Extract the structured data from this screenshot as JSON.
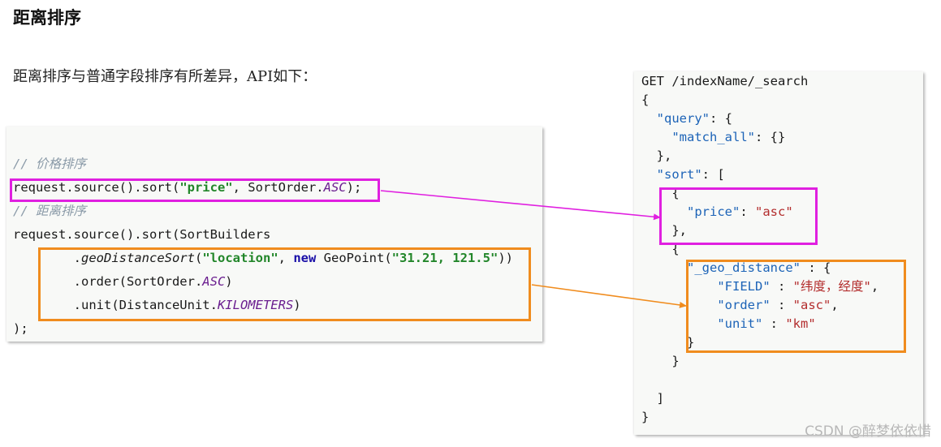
{
  "title": "距离排序",
  "description": "距离排序与普通字段排序有所差异，API如下：",
  "java": {
    "comment_price": "// 价格排序",
    "price_sort": {
      "prefix": "request.source().sort(",
      "field": "\"price\"",
      "mid": ", SortOrder.",
      "order": "ASC",
      "suffix": ");"
    },
    "comment_distance": "// 距离排序",
    "distance_line": "request.source().sort(SortBuilders",
    "geo_line": {
      "dot": ".",
      "method": "geoDistanceSort",
      "open": "(",
      "field": "\"location\"",
      "sep": ", ",
      "new_kw": "new",
      "geopoint": " GeoPoint(",
      "coords": "\"31.21, 121.5\"",
      "close": "))"
    },
    "order_line": {
      "prefix": ".order(SortOrder.",
      "value": "ASC",
      "suffix": ")"
    },
    "unit_line": {
      "prefix": ".unit(DistanceUnit.",
      "value": "KILOMETERS",
      "suffix": ")"
    },
    "end": ");"
  },
  "json": {
    "request": "GET /indexName/_search",
    "open": "{",
    "query_key": "\"query\"",
    "query_open": ": {",
    "match_all_key": "\"match_all\"",
    "match_all_val": ": {}",
    "query_close": "},",
    "sort_key": "\"sort\"",
    "sort_open": ": [",
    "obj_open": "{",
    "price_key": "\"price\"",
    "colon": ": ",
    "price_val": "\"asc\"",
    "obj_close_comma": "},",
    "obj2_open": "{",
    "geo_key": "\"_geo_distance\"",
    "geo_open": " : {",
    "field_key": "\"FIELD\"",
    "sep": " : ",
    "field_val": "\"纬度，经度\"",
    "order_key": "\"order\"",
    "order_val": "\"asc\"",
    "unit_key": "\"unit\"",
    "unit_val": "\"km\"",
    "comma": ",",
    "geo_close": "}",
    "obj2_close": "}",
    "sort_close": "]",
    "close": "}"
  },
  "watermark": "CSDN @醉梦依依惜",
  "colors": {
    "magenta_highlight": "#e020e0",
    "orange_highlight": "#f08c1e",
    "string": "#22862a",
    "keyword": "#1a0fa8",
    "enum": "#6a1d8f",
    "json_key": "#1c63b7",
    "json_value": "#b32d2d"
  }
}
